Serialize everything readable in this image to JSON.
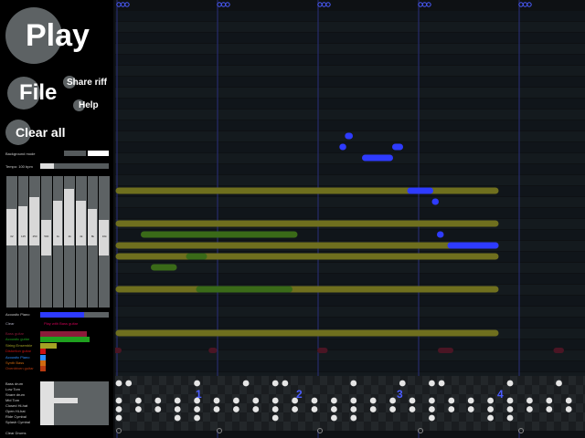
{
  "controls": {
    "play": "Play",
    "file": "File",
    "share": "Share riff",
    "help": "Help",
    "clear": "Clear all"
  },
  "settings": {
    "background_mode": "Background mode",
    "tempo_label": "Tempo: 100 bpm",
    "tempo_fraction": 0.2
  },
  "equalizer": {
    "labels": [
      "32",
      "125",
      "250",
      "500",
      "1k",
      "2k",
      "4k",
      "8k",
      "16k"
    ],
    "levels": [
      0.55,
      0.6,
      0.75,
      0.45,
      0.7,
      0.9,
      0.7,
      0.55,
      0.45
    ]
  },
  "instrument_panel": {
    "active_label": "Acoustic Piano",
    "active_color": "#2e3bff",
    "add_label": "Clear",
    "add_hint": "Play with Bass guitar",
    "instruments": [
      {
        "name": "Bass guitar",
        "color": "#8b1a3a",
        "level": 0.85
      },
      {
        "name": "Acoustic guitar",
        "color": "#1fa01f",
        "level": 0.9
      },
      {
        "name": "String Ensemble",
        "color": "#a3a324",
        "level": 0.3
      },
      {
        "name": "Distortion guitar",
        "color": "#cc1111",
        "level": 0.1
      },
      {
        "name": "Acoustic Piano",
        "color": "#2e8fff",
        "level": 0.1
      },
      {
        "name": "Synth Bass",
        "color": "#d06a10",
        "level": 0.1
      },
      {
        "name": "Overdriven guitar",
        "color": "#b83a10",
        "level": 0.1
      }
    ]
  },
  "drums": {
    "names": [
      "Bass drum",
      "Low Tom",
      "Snare drum",
      "Mid Tom",
      "Closed Hi-hat",
      "Open Hi-hat",
      "Ride Cymbal",
      "Splash Cymbal"
    ],
    "levels": [
      0.2,
      0.2,
      0.2,
      0.55,
      0.2,
      0.2,
      0.2,
      0.2
    ],
    "clear_label": "Clear Drums"
  },
  "sequencer": {
    "beat_numbers": [
      "1",
      "2",
      "3",
      "4"
    ],
    "colors": {
      "piano": "#2e3bff",
      "string": "#6f6f1e",
      "guitar": "#3a6a18",
      "bass": "#4a1524"
    },
    "notes": [
      {
        "type": "string",
        "start": 0,
        "end": 3.8,
        "row": 16
      },
      {
        "type": "string",
        "start": 0,
        "end": 3.8,
        "row": 21
      },
      {
        "type": "string",
        "start": 0,
        "end": 3.8,
        "row": 19
      },
      {
        "type": "string",
        "start": 0,
        "end": 3.8,
        "row": 22
      },
      {
        "type": "string",
        "start": 0,
        "end": 3.8,
        "row": 25
      },
      {
        "type": "string",
        "start": 0,
        "end": 3.8,
        "row": 29
      },
      {
        "type": "guitar",
        "start": 0.25,
        "end": 1.8,
        "row": 20
      },
      {
        "type": "guitar",
        "start": 0.35,
        "end": 0.6,
        "row": 23
      },
      {
        "type": "guitar",
        "start": 0.8,
        "end": 1.75,
        "row": 25
      },
      {
        "type": "guitar",
        "start": 0.7,
        "end": 0.9,
        "row": 22
      },
      {
        "type": "piano",
        "start": 2.28,
        "end": 2.35,
        "row": 11
      },
      {
        "type": "piano",
        "start": 2.45,
        "end": 2.75,
        "row": 13
      },
      {
        "type": "piano",
        "start": 2.23,
        "end": 2.28,
        "row": 12
      },
      {
        "type": "piano",
        "start": 2.75,
        "end": 2.85,
        "row": 12
      },
      {
        "type": "piano",
        "start": 2.9,
        "end": 3.15,
        "row": 16
      },
      {
        "type": "piano",
        "start": 3.15,
        "end": 3.2,
        "row": 17
      },
      {
        "type": "piano",
        "start": 3.3,
        "end": 3.8,
        "row": 21
      },
      {
        "type": "piano",
        "start": 3.2,
        "end": 3.25,
        "row": 20
      }
    ],
    "drum_rows": [
      [
        1,
        1,
        0,
        0,
        0,
        0,
        0,
        0,
        1,
        0,
        0,
        0,
        0,
        1,
        0,
        0,
        1,
        1,
        0,
        0,
        0,
        0,
        0,
        0,
        1,
        0,
        0,
        0,
        0,
        1,
        0,
        0,
        1,
        1,
        0,
        0,
        0,
        0,
        0,
        0,
        1,
        0,
        0,
        0,
        0,
        1,
        0,
        0
      ],
      [
        0,
        0,
        0,
        0,
        0,
        0,
        0,
        0,
        0,
        0,
        0,
        0,
        0,
        0,
        0,
        0,
        0,
        0,
        0,
        0,
        0,
        0,
        0,
        0,
        0,
        0,
        0,
        0,
        0,
        0,
        0,
        0,
        0,
        0,
        0,
        0,
        0,
        0,
        0,
        0,
        0,
        0,
        0,
        0,
        0,
        0,
        0,
        0
      ],
      [
        1,
        0,
        1,
        0,
        1,
        0,
        1,
        0,
        1,
        0,
        1,
        0,
        1,
        0,
        1,
        0,
        1,
        0,
        1,
        0,
        1,
        0,
        1,
        0,
        1,
        0,
        1,
        0,
        1,
        0,
        1,
        0,
        1,
        0,
        1,
        0,
        1,
        0,
        1,
        0,
        1,
        0,
        1,
        0,
        1,
        0,
        1,
        0
      ],
      [
        1,
        0,
        1,
        0,
        1,
        0,
        1,
        0,
        1,
        0,
        1,
        0,
        1,
        0,
        1,
        0,
        1,
        0,
        1,
        0,
        1,
        0,
        1,
        0,
        1,
        0,
        1,
        0,
        1,
        0,
        1,
        0,
        1,
        0,
        1,
        0,
        1,
        0,
        1,
        0,
        1,
        0,
        1,
        0,
        1,
        0,
        1,
        0
      ],
      [
        1,
        0,
        0,
        0,
        0,
        0,
        1,
        0,
        1,
        0,
        0,
        0,
        0,
        0,
        0,
        0,
        1,
        0,
        0,
        0,
        0,
        0,
        1,
        0,
        1,
        0,
        0,
        0,
        0,
        0,
        0,
        0,
        1,
        0,
        0,
        0,
        0,
        0,
        1,
        0,
        1,
        0,
        0,
        0,
        0,
        0,
        0,
        0
      ]
    ]
  }
}
